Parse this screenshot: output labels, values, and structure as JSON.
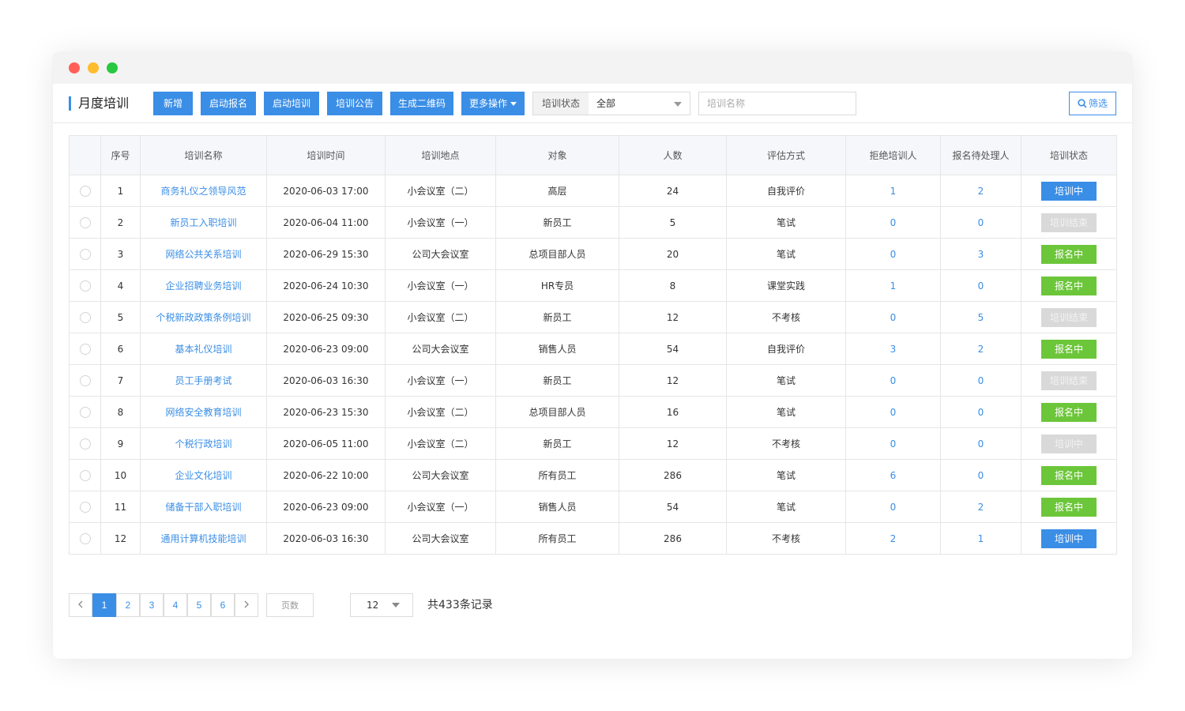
{
  "page": {
    "title": "月度培训"
  },
  "toolbar": {
    "buttons": [
      "新增",
      "启动报名",
      "启动培训",
      "培训公告",
      "生成二维码",
      "更多操作"
    ],
    "status_label": "培训状态",
    "status_value": "全部",
    "name_placeholder": "培训名称",
    "filter_label": "筛选"
  },
  "table": {
    "headers": [
      "序号",
      "培训名称",
      "培训时间",
      "培训地点",
      "对象",
      "人数",
      "评估方式",
      "拒绝培训人",
      "报名待处理人",
      "培训状态"
    ],
    "rows": [
      [
        "1",
        "商务礼仪之领导风范",
        "2020-06-03 17:00",
        "小会议室（二）",
        "高层",
        "24",
        "自我评价",
        "1",
        "2",
        "培训中"
      ],
      [
        "2",
        "新员工入职培训",
        "2020-06-04 11:00",
        "小会议室（一）",
        "新员工",
        "5",
        "笔试",
        "0",
        "0",
        "培训结束"
      ],
      [
        "3",
        "网络公共关系培训",
        "2020-06-29 15:30",
        "公司大会议室",
        "总项目部人员",
        "20",
        "笔试",
        "0",
        "3",
        "报名中"
      ],
      [
        "4",
        "企业招聘业务培训",
        "2020-06-24 10:30",
        "小会议室（一）",
        "HR专员",
        "8",
        "课堂实践",
        "1",
        "0",
        "报名中"
      ],
      [
        "5",
        "个税新政政策条例培训",
        "2020-06-25 09:30",
        "小会议室（二）",
        "新员工",
        "12",
        "不考核",
        "0",
        "5",
        "培训结束"
      ],
      [
        "6",
        "基本礼仪培训",
        "2020-06-23 09:00",
        "公司大会议室",
        "销售人员",
        "54",
        "自我评价",
        "3",
        "2",
        "报名中"
      ],
      [
        "7",
        "员工手册考试",
        "2020-06-03 16:30",
        "小会议室（一）",
        "新员工",
        "12",
        "笔试",
        "0",
        "0",
        "培训结束"
      ],
      [
        "8",
        "网络安全教育培训",
        "2020-06-23 15:30",
        "小会议室（二）",
        "总项目部人员",
        "16",
        "笔试",
        "0",
        "0",
        "报名中"
      ],
      [
        "9",
        "个税行政培训",
        "2020-06-05 11:00",
        "小会议室（二）",
        "新员工",
        "12",
        "不考核",
        "0",
        "0",
        "培训中"
      ],
      [
        "10",
        "企业文化培训",
        "2020-06-22 10:00",
        "公司大会议室",
        "所有员工",
        "286",
        "笔试",
        "6",
        "0",
        "报名中"
      ],
      [
        "11",
        "储备干部入职培训",
        "2020-06-23 09:00",
        "小会议室（一）",
        "销售人员",
        "54",
        "笔试",
        "0",
        "2",
        "报名中"
      ],
      [
        "12",
        "通用计算机技能培训",
        "2020-06-03 16:30",
        "公司大会议室",
        "所有员工",
        "286",
        "不考核",
        "2",
        "1",
        "培训中"
      ]
    ],
    "status_colors": [
      "blue",
      "gray",
      "green",
      "green",
      "gray",
      "green",
      "gray",
      "green",
      "gray",
      "green",
      "green",
      "blue"
    ]
  },
  "pagination": {
    "pages": [
      "1",
      "2",
      "3",
      "4",
      "5",
      "6"
    ],
    "current": "1",
    "page_input_placeholder": "页数",
    "page_size": "12",
    "total_text": "共433条记录"
  },
  "colors": {
    "primary": "#3a8ee6",
    "success": "#6cc63a",
    "disabled": "#d9d9d9"
  }
}
